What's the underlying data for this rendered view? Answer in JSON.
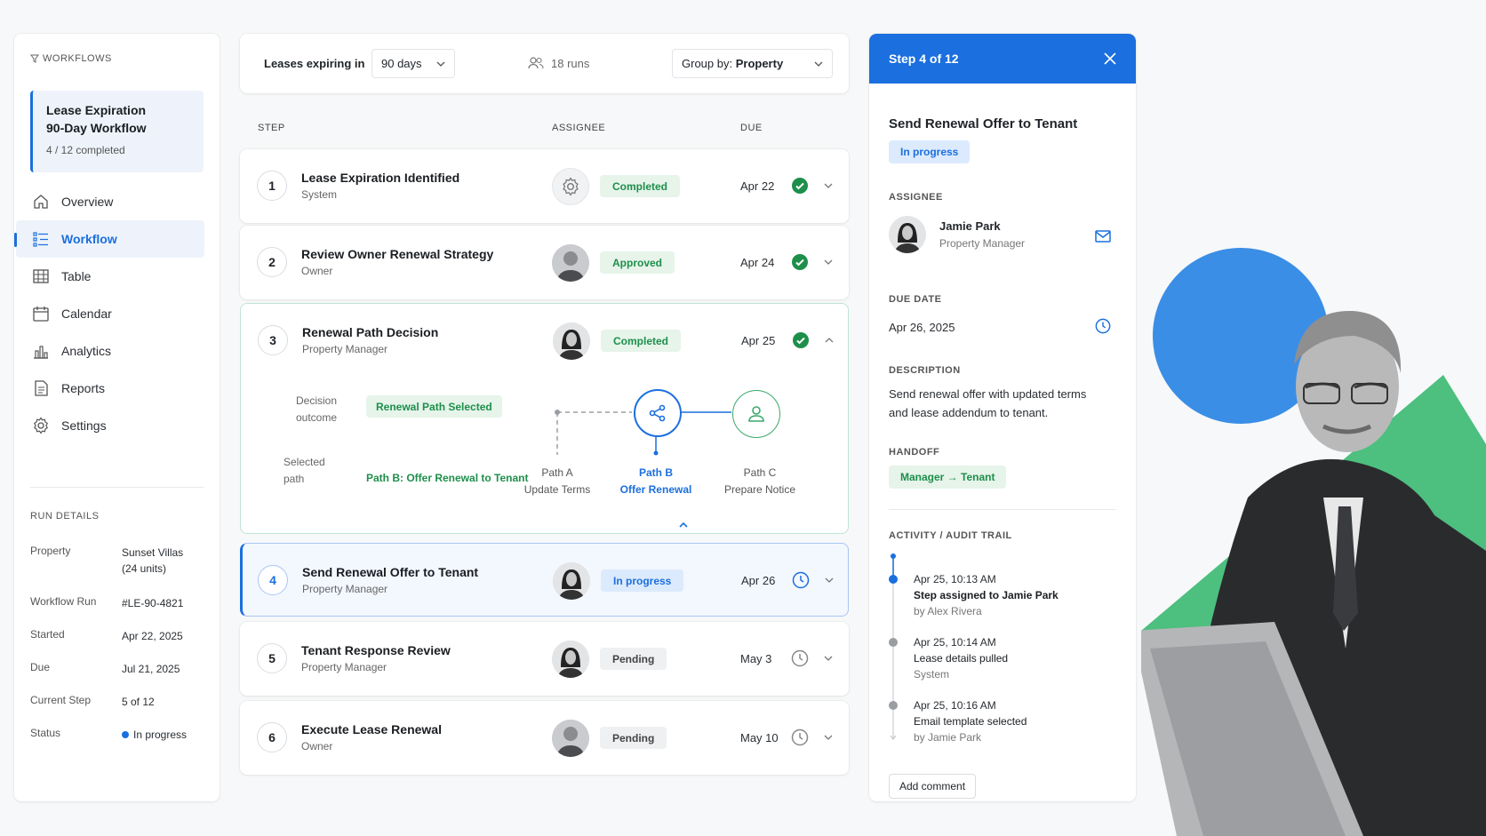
{
  "sidebar": {
    "section_title": "WORKFLOWS",
    "workflow_title_line1": "Lease Expiration",
    "workflow_title_line2": "90-Day Workflow",
    "workflow_progress": "4 / 12 completed",
    "nav": [
      {
        "label": "Overview",
        "icon": "home-icon"
      },
      {
        "label": "Workflow",
        "icon": "workflow-icon",
        "active": true
      },
      {
        "label": "Table",
        "icon": "table-icon"
      },
      {
        "label": "Calendar",
        "icon": "calendar-icon"
      },
      {
        "label": "Analytics",
        "icon": "analytics-icon"
      },
      {
        "label": "Reports",
        "icon": "reports-icon"
      },
      {
        "label": "Settings",
        "icon": "settings-icon"
      }
    ],
    "run_details_title": "RUN DETAILS",
    "run_details": [
      {
        "label": "Property",
        "value_line1": "Sunset Villas",
        "value_line2": "(24 units)"
      },
      {
        "label": "Workflow Run",
        "value_line1": "#LE-90-4821"
      },
      {
        "label": "Started",
        "value_line1": "Apr 22, 2025"
      },
      {
        "label": "Due",
        "value_line1": "Jul 21, 2025"
      },
      {
        "label": "Current Step",
        "value_line1": "5 of 12"
      },
      {
        "label": "Status",
        "value_line1": "In progress"
      }
    ]
  },
  "filters": {
    "label": "Leases expiring in",
    "period": "90 days",
    "runs": "18 runs",
    "group_prefix": "Group by:",
    "group_value": "Property"
  },
  "table": {
    "headers": {
      "step": "STEP",
      "assignee": "ASSIGNEE",
      "due": "DUE"
    },
    "rows": [
      {
        "num": "1",
        "title": "Lease Expiration Identified",
        "sub": "System",
        "status": "Completed",
        "due": "Apr 22"
      },
      {
        "num": "2",
        "title": "Review Owner Renewal Strategy",
        "sub": "Owner",
        "status": "Approved",
        "due": "Apr 24"
      },
      {
        "num": "3",
        "title": "Renewal Path Decision",
        "sub": "Property Manager",
        "status": "Completed",
        "due": "Apr 25"
      },
      {
        "num": "4",
        "title": "Send Renewal Offer to Tenant",
        "sub": "Property Manager",
        "status": "In progress",
        "due": "Apr 26"
      },
      {
        "num": "5",
        "title": "Tenant Response Review",
        "sub": "Property Manager",
        "status": "Pending",
        "due": "May 3"
      },
      {
        "num": "6",
        "title": "Execute Lease Renewal",
        "sub": "Owner",
        "status": "Pending",
        "due": "May 10"
      }
    ],
    "decision": {
      "outcome_label_line1": "Decision",
      "outcome_label_line2": "outcome",
      "outcome_value": "Renewal Path Selected",
      "path_label_line1": "Selected",
      "path_label_line2": "path",
      "path_value": "Path B: Offer Renewal to Tenant",
      "paths": [
        {
          "line1": "Path A",
          "line2": "Update Terms"
        },
        {
          "line1": "Path B",
          "line2": "Offer Renewal"
        },
        {
          "line1": "Path C",
          "line2": "Prepare Notice"
        }
      ]
    }
  },
  "panel": {
    "step_label": "Step 4 of 12",
    "title": "Send Renewal Offer to Tenant",
    "status": "In progress",
    "assignee_heading": "ASSIGNEE",
    "assignee_name": "Jamie Park",
    "assignee_role": "Property Manager",
    "due_heading": "DUE DATE",
    "due_value": "Apr 26, 2025",
    "description_heading": "DESCRIPTION",
    "description_line1": "Send renewal offer with updated terms",
    "description_line2": "and lease addendum to tenant.",
    "handoff_heading": "HANDOFF",
    "handoff_value": "Manager → Tenant",
    "activity_heading": "ACTIVITY / AUDIT TRAIL",
    "activity": [
      {
        "time": "Apr 25, 10:13 AM",
        "action": "Step assigned to Jamie Park",
        "by": "by Alex Rivera"
      },
      {
        "time": "Apr 25, 10:14 AM",
        "action": "Lease details pulled",
        "by": "System"
      },
      {
        "time": "Apr 25, 10:16 AM",
        "action": "Email template selected",
        "by": "by Jamie Park"
      }
    ],
    "add_comment": "Add comment"
  },
  "colors": {
    "accent": "#1b6fde",
    "success": "#1e8f4b",
    "deco_blue": "#3a8ee6",
    "deco_green": "#4dbf7f"
  }
}
